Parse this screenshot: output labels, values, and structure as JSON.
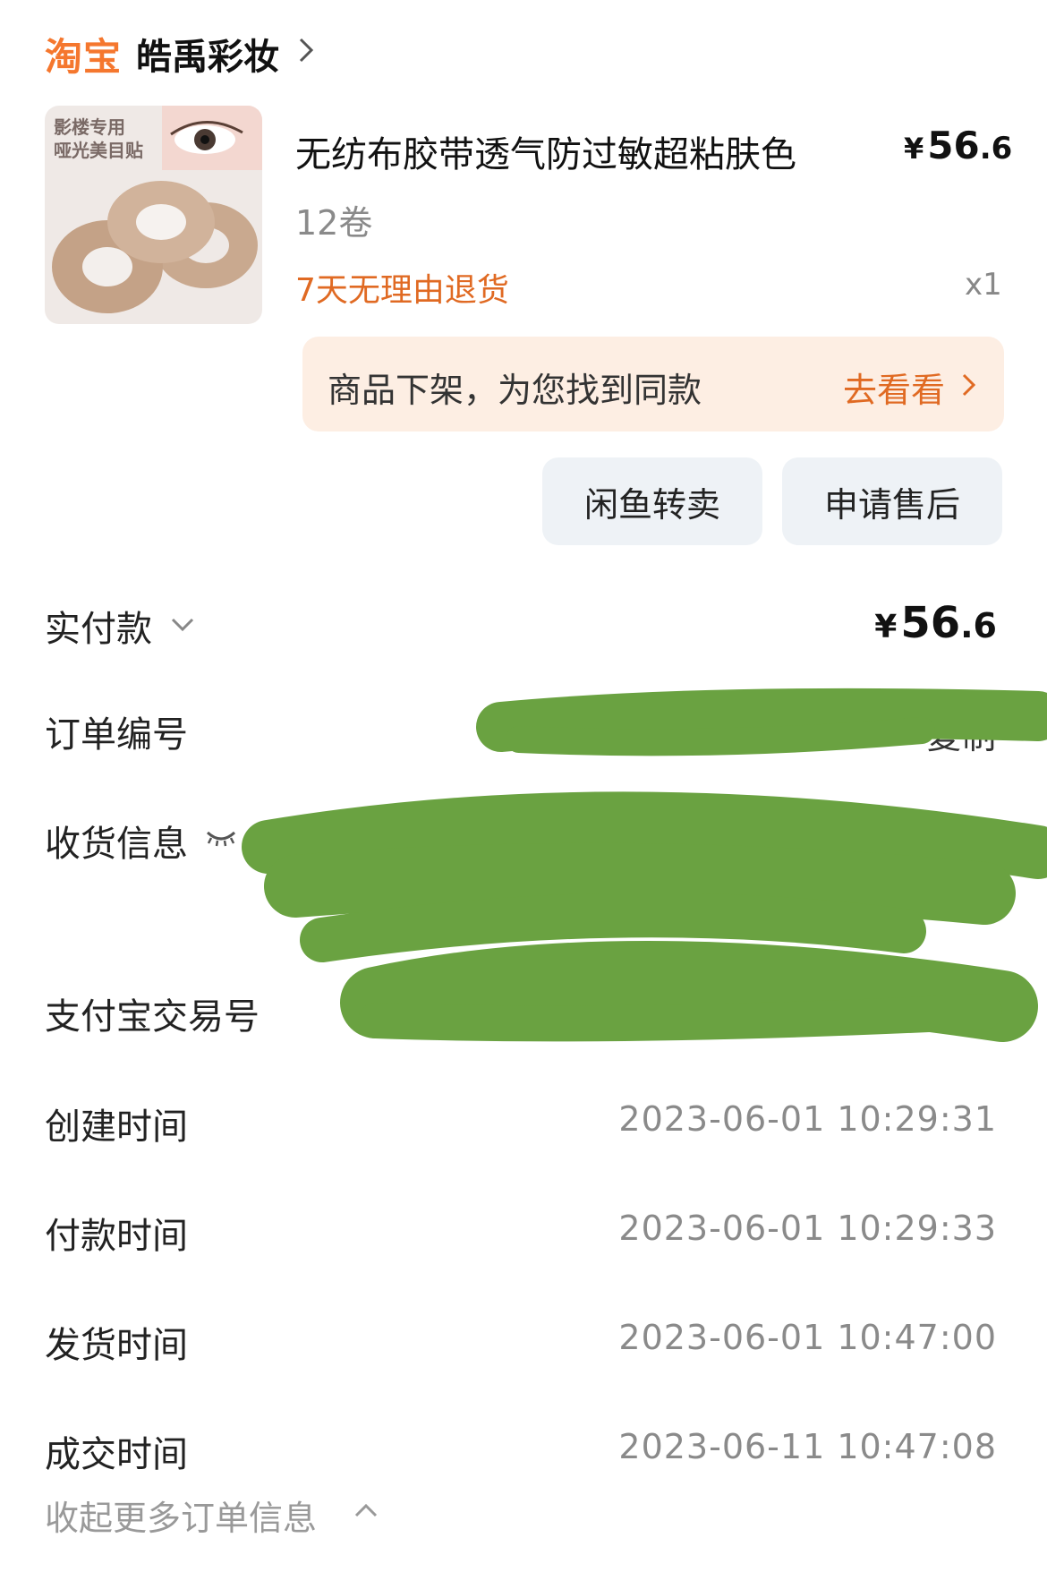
{
  "header": {
    "brand": "淘宝",
    "shop_name": "皓禹彩妆"
  },
  "product": {
    "image_tag_line1": "影楼专用",
    "image_tag_line2": "哑光美目贴",
    "title": "无纺布胶带透气防过敏超粘肤色",
    "price_symbol": "¥",
    "price_int": "56",
    "price_dec": ".6",
    "spec": "12卷",
    "refund_policy": "7天无理由退货",
    "quantity": "x1"
  },
  "notice": {
    "text": "商品下架，为您找到同款",
    "link_label": "去看看"
  },
  "actions": {
    "resell_label": "闲鱼转卖",
    "after_sale_label": "申请售后"
  },
  "order_info": {
    "paid": {
      "label": "实付款",
      "symbol": "¥",
      "amount_int": "56",
      "amount_dec": ".6"
    },
    "order_no": {
      "label": "订单编号",
      "copy_label": "复制"
    },
    "shipping": {
      "label": "收货信息"
    },
    "alipay_no": {
      "label": "支付宝交易号"
    },
    "created": {
      "label": "创建时间",
      "value": "2023-06-01 10:29:31"
    },
    "paid_time": {
      "label": "付款时间",
      "value": "2023-06-01 10:29:33"
    },
    "shipped": {
      "label": "发货时间",
      "value": "2023-06-01 10:47:00"
    },
    "closed": {
      "label": "成交时间",
      "value": "2023-06-11 10:47:08"
    },
    "collapse_label": "收起更多订单信息"
  },
  "colors": {
    "accent": "#e06a23",
    "brand": "#f5772e",
    "notice_bg": "#fdeee3",
    "button_bg": "#eef2f6",
    "redaction": "#6aa241"
  },
  "icons": [
    "chevron-right-icon",
    "chevron-down-icon",
    "eye-closed-icon",
    "chevron-up-icon"
  ]
}
